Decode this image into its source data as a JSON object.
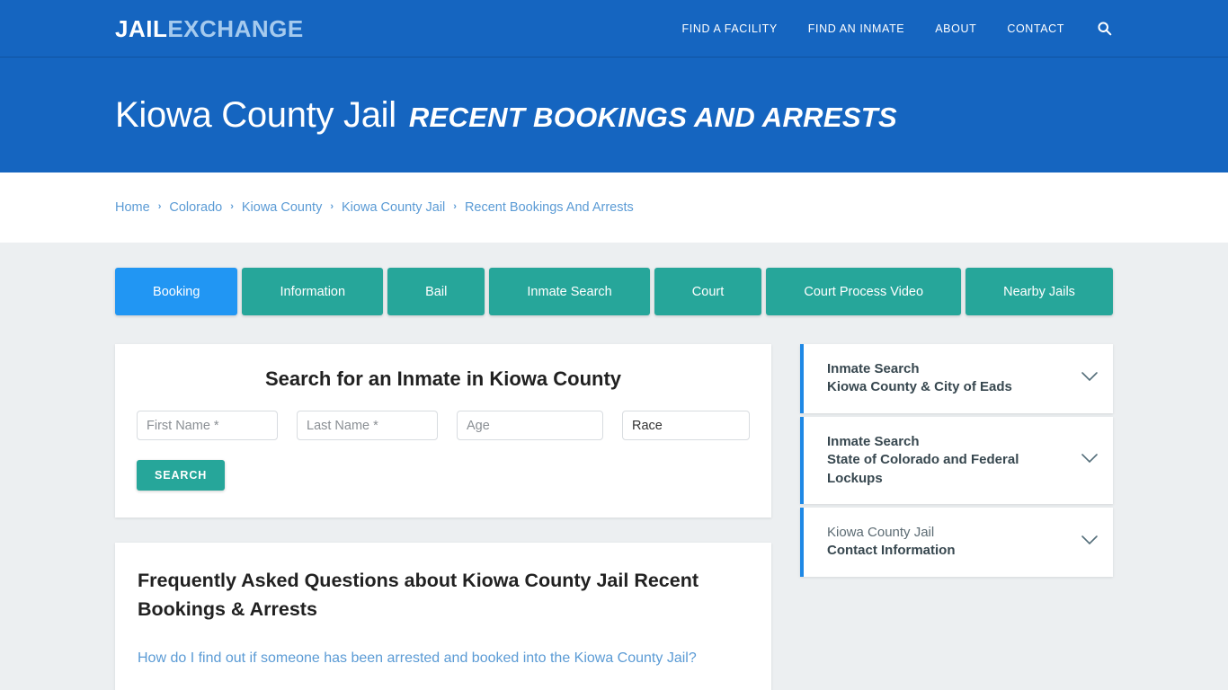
{
  "header": {
    "logo_primary": "JAIL",
    "logo_secondary": "EXCHANGE",
    "nav": [
      {
        "label": "FIND A FACILITY"
      },
      {
        "label": "FIND AN INMATE"
      },
      {
        "label": "ABOUT"
      },
      {
        "label": "CONTACT"
      }
    ],
    "search_icon": "search-icon",
    "brand_color": "#1565c0"
  },
  "title": {
    "main": "Kiowa County Jail",
    "sub": "RECENT BOOKINGS AND ARRESTS"
  },
  "breadcrumb": {
    "separator": "›",
    "items": [
      {
        "label": "Home"
      },
      {
        "label": "Colorado"
      },
      {
        "label": "Kiowa County"
      },
      {
        "label": "Kiowa County Jail"
      },
      {
        "label": "Recent Bookings And Arrests"
      }
    ]
  },
  "tabs": {
    "active_index": 0,
    "active_color": "#2196f3",
    "inactive_color": "#26a69a",
    "items": [
      {
        "label": "Booking"
      },
      {
        "label": "Information"
      },
      {
        "label": "Bail"
      },
      {
        "label": "Inmate Search"
      },
      {
        "label": "Court"
      },
      {
        "label": "Court Process Video"
      },
      {
        "label": "Nearby Jails"
      }
    ]
  },
  "search_panel": {
    "heading": "Search for an Inmate in Kiowa County",
    "first_name_placeholder": "First Name *",
    "first_name_value": "",
    "last_name_placeholder": "Last Name *",
    "last_name_value": "",
    "age_placeholder": "Age",
    "age_value": "",
    "race_selected": "Race",
    "race_options": [
      "Race"
    ],
    "submit_label": "SEARCH",
    "submit_color": "#26a69a"
  },
  "faq": {
    "heading": "Frequently Asked Questions about Kiowa County Jail Recent Bookings & Arrests",
    "questions": [
      {
        "text": "How do I find out if someone has been arrested and booked into the Kiowa County Jail?"
      }
    ],
    "link_color": "#5b9bd5"
  },
  "sidebar": {
    "accent_color": "#1e88e5",
    "items": [
      {
        "line1": "Inmate Search",
        "line2": "Kiowa County & City of Eads",
        "line1_light": false,
        "icon": "chevron-down-icon"
      },
      {
        "line1": "Inmate Search",
        "line2": "State of Colorado and Federal Lockups",
        "line1_light": false,
        "icon": "chevron-down-icon"
      },
      {
        "line1": "Kiowa County Jail",
        "line2": "Contact Information",
        "line1_light": true,
        "icon": "chevron-down-icon"
      }
    ]
  }
}
